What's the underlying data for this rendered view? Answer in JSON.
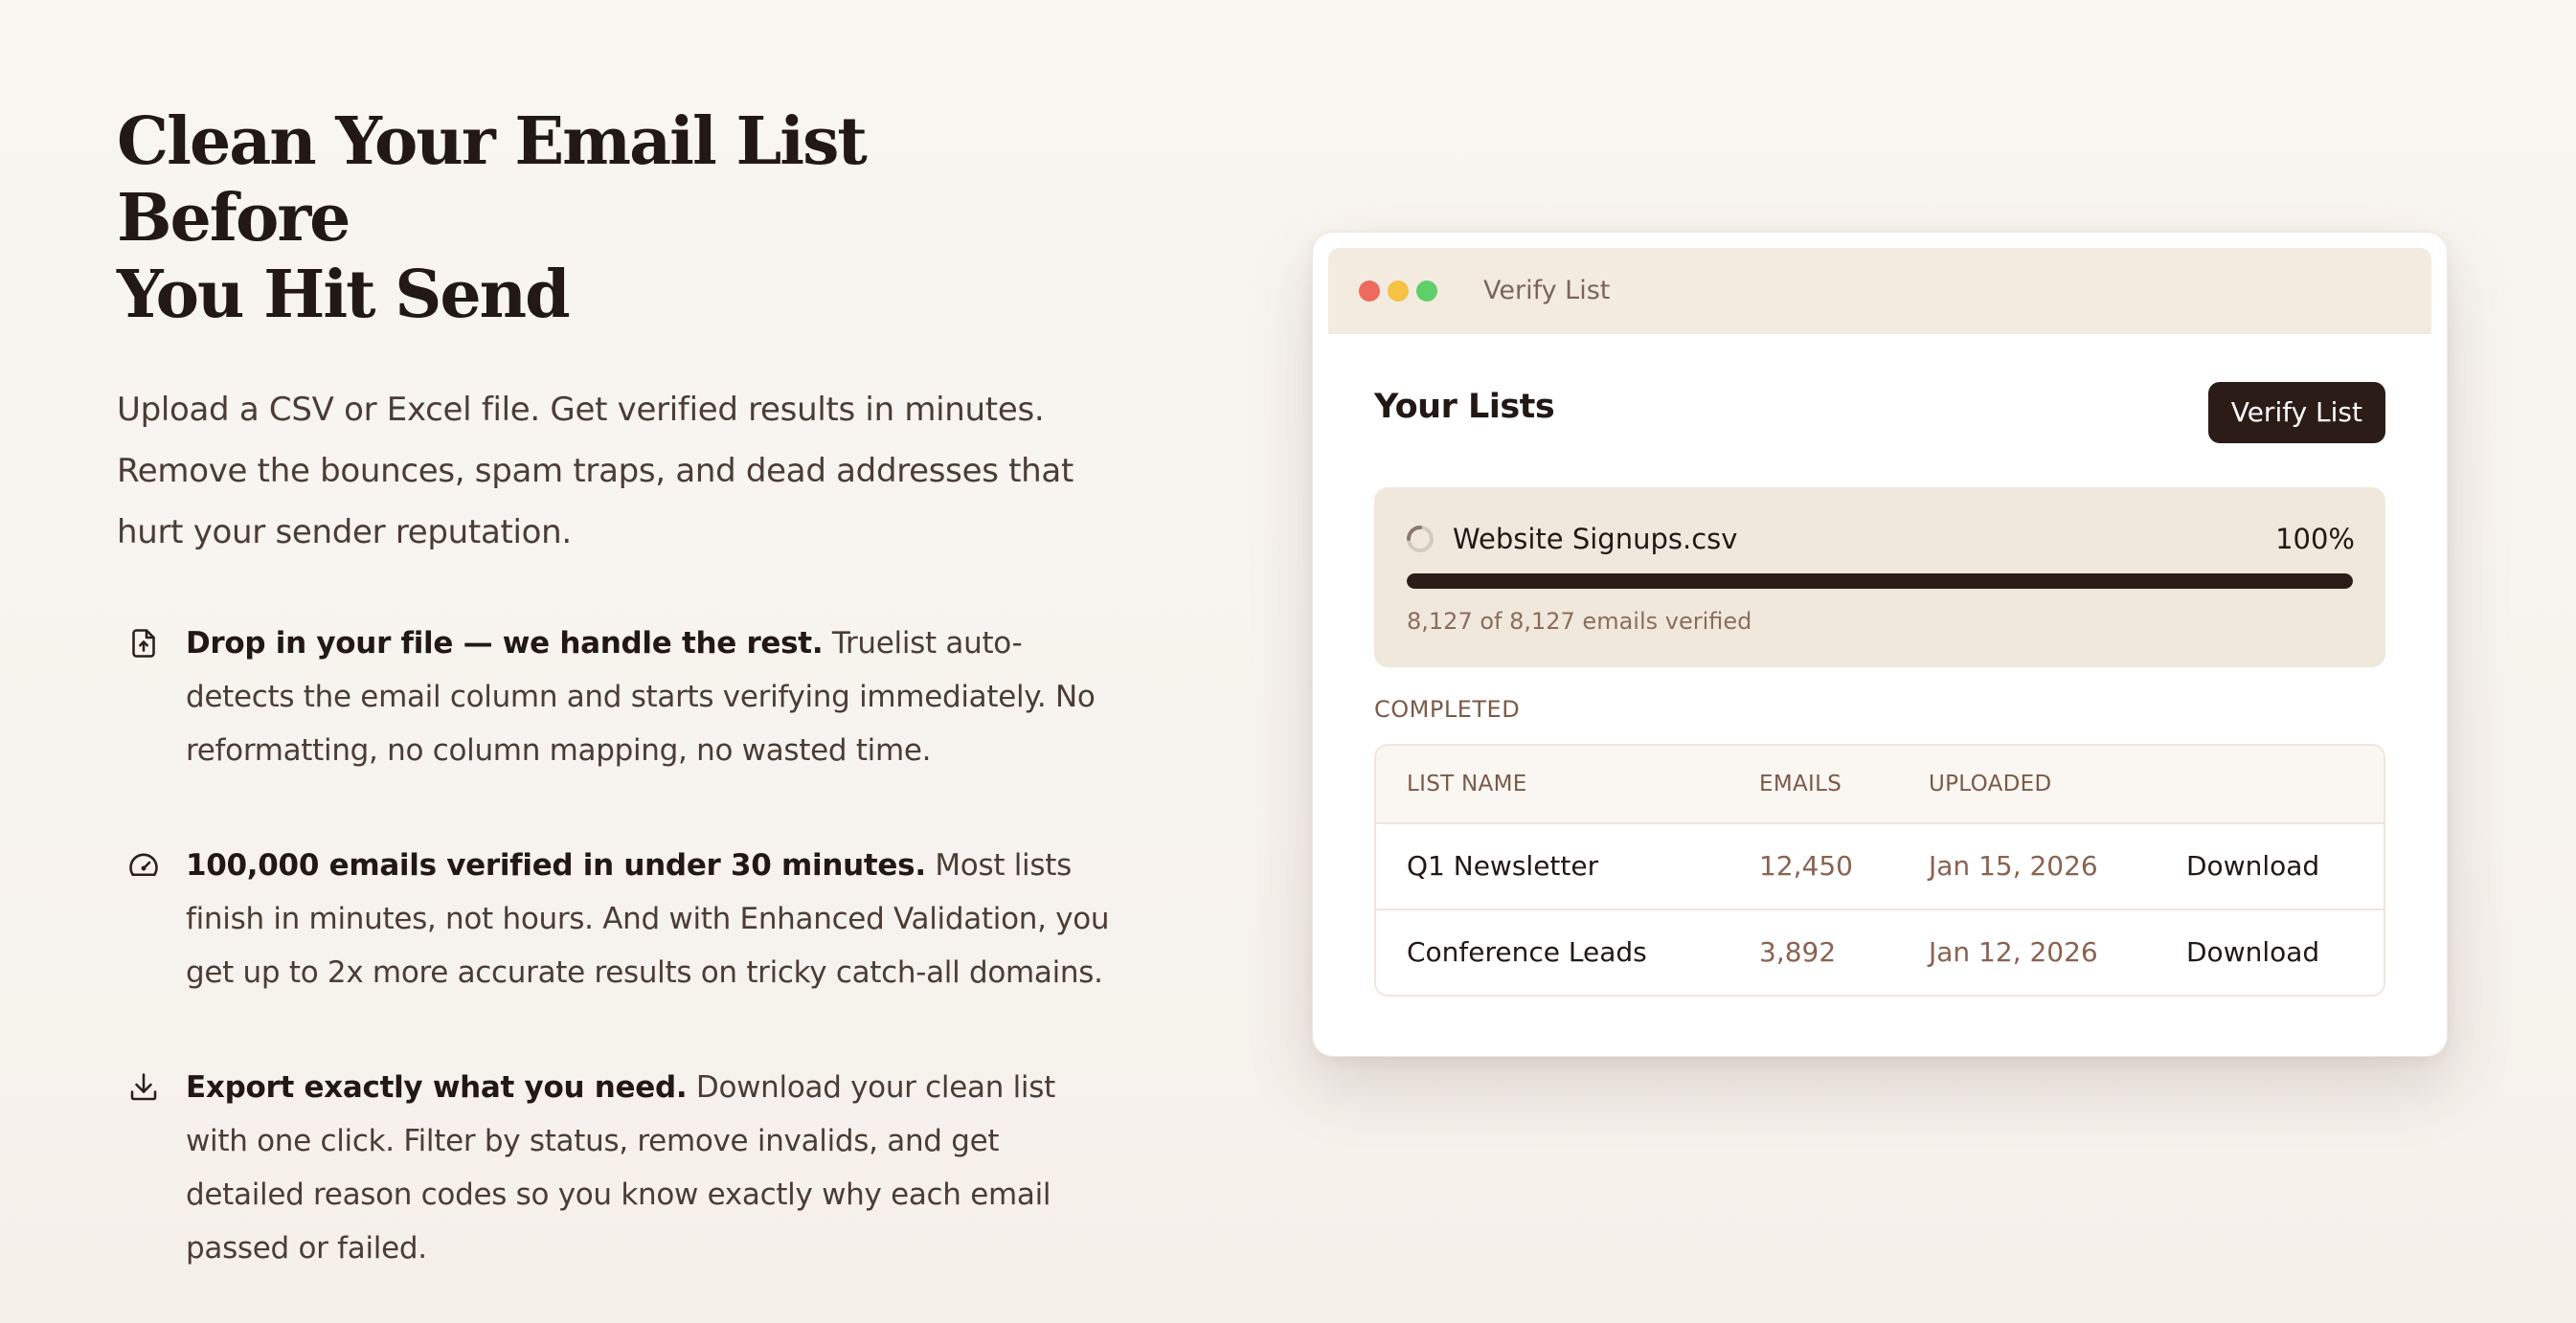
{
  "hero": {
    "headline_line1": "Clean Your Email List Before",
    "headline_line2": "You Hit Send",
    "intro": "Upload a CSV or Excel file. Get verified results in minutes. Remove the bounces, spam traps, and dead addresses that hurt your sender reputation."
  },
  "features": [
    {
      "icon": "file-upload-icon",
      "title": "Drop in your file — we handle the rest.",
      "body": "Truelist auto-detects the email column and starts verifying immediately. No reformatting, no column mapping, no wasted time."
    },
    {
      "icon": "speedometer-icon",
      "title": "100,000 emails verified in under 30 minutes.",
      "body": "Most lists finish in minutes, not hours. And with Enhanced Validation, you get up to 2x more accurate results on tricky catch-all domains."
    },
    {
      "icon": "download-icon",
      "title": "Export exactly what you need.",
      "body": "Download your clean list with one click. Filter by status, remove invalids, and get detailed reason codes so you know exactly why each email passed or failed."
    }
  ],
  "window": {
    "title": "Verify List",
    "lists_title": "Your Lists",
    "verify_button": "Verify List",
    "progress": {
      "file_name": "Website Signups.csv",
      "percent_label": "100%",
      "fraction": 1.0,
      "status": "8,127 of 8,127 emails verified"
    },
    "completed_label": "COMPLETED",
    "table": {
      "headers": [
        "LIST NAME",
        "EMAILS",
        "UPLOADED"
      ],
      "rows": [
        {
          "name": "Q1 Newsletter",
          "emails": "12,450",
          "uploaded": "Jan 15, 2026",
          "action": "Download"
        },
        {
          "name": "Conference Leads",
          "emails": "3,892",
          "uploaded": "Jan 12, 2026",
          "action": "Download"
        }
      ]
    }
  },
  "colors": {
    "background": "#f8f4ef",
    "ink": "#221815",
    "accent_dark": "#2c1c18",
    "muted": "#8a6250",
    "card": "#f1e8dd"
  }
}
